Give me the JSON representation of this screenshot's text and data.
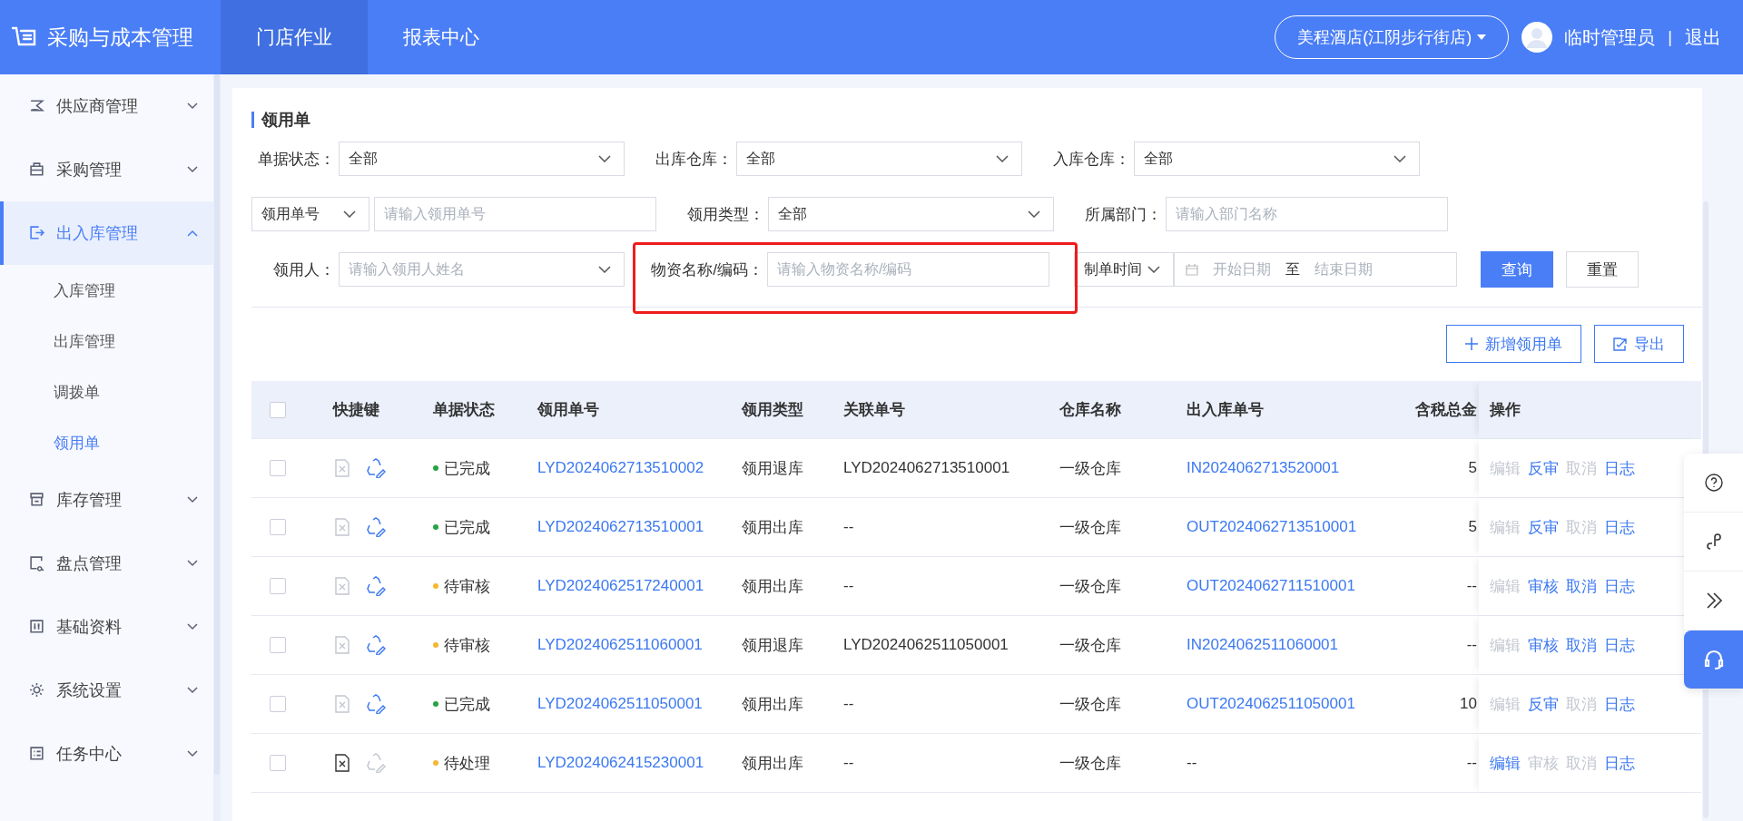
{
  "header": {
    "app_title": "采购与成本管理",
    "nav": [
      {
        "label": "门店作业",
        "selected": true
      },
      {
        "label": "报表中心",
        "selected": false
      }
    ],
    "store": "美程酒店(江阴步行街店)",
    "user": "临时管理员",
    "separator": "|",
    "logout": "退出"
  },
  "sidebar": {
    "items": [
      {
        "label": "供应商管理",
        "expanded": false,
        "selected": false
      },
      {
        "label": "采购管理",
        "expanded": false,
        "selected": false
      },
      {
        "label": "出入库管理",
        "expanded": true,
        "selected": true,
        "children": [
          {
            "label": "入库管理",
            "selected": false
          },
          {
            "label": "出库管理",
            "selected": false
          },
          {
            "label": "调拨单",
            "selected": false
          },
          {
            "label": "领用单",
            "selected": true
          }
        ]
      },
      {
        "label": "库存管理",
        "expanded": false,
        "selected": false
      },
      {
        "label": "盘点管理",
        "expanded": false,
        "selected": false
      },
      {
        "label": "基础资料",
        "expanded": false,
        "selected": false
      },
      {
        "label": "系统设置",
        "expanded": false,
        "selected": false
      },
      {
        "label": "任务中心",
        "expanded": false,
        "selected": false
      }
    ]
  },
  "page_title": "领用单",
  "filters": [
    [
      {
        "kind": "select",
        "label": "单据状态：",
        "value": "全部"
      },
      {
        "kind": "select",
        "label": "出库仓库：",
        "value": "全部"
      },
      {
        "kind": "select",
        "label": "入库仓库：",
        "value": "全部"
      }
    ],
    [
      {
        "kind": "combo",
        "value": "领用单号",
        "placeholder": "请输入领用单号"
      },
      {
        "kind": "select",
        "label": "领用类型：",
        "value": "全部"
      },
      {
        "kind": "input",
        "label": "所属部门：",
        "placeholder": "请输入部门名称"
      }
    ],
    [
      {
        "kind": "select",
        "label": "领用人：",
        "placeholder": "请输入领用人姓名"
      },
      {
        "kind": "input",
        "label": "物资名称/编码：",
        "placeholder": "请输入物资名称/编码"
      },
      {
        "kind": "daterange",
        "value": "制单时间",
        "start": "开始日期",
        "separator": "至",
        "end": "结束日期"
      },
      {
        "kind": "button",
        "label": "查询",
        "primary": true
      },
      {
        "kind": "button",
        "label": "重置",
        "primary": false
      }
    ]
  ],
  "annotation": {
    "kind": "highlight-box"
  },
  "actions": [
    {
      "kind": "add",
      "label": "新增领用单"
    },
    {
      "kind": "export",
      "label": "导出"
    }
  ],
  "table": {
    "select_all": {
      "checked": false
    },
    "columns": [
      "快捷键",
      "单据状态",
      "领用单号",
      "领用类型",
      "关联单号",
      "仓库名称",
      "出入库单号",
      "含税总金",
      "操作"
    ],
    "rows": [
      {
        "checked": false,
        "shortcuts": [
          {
            "kind": "void",
            "disabled": true
          },
          {
            "kind": "reverse",
            "disabled": false
          }
        ],
        "status": "已完成",
        "color": "#27a243",
        "number": "LYD2024062713510002",
        "type": "领用退库",
        "related": "LYD2024062713510001",
        "warehouse": "一级仓库",
        "io_number": "IN2024062713520001",
        "io_link": true,
        "amount": "5",
        "ops": [
          {
            "label": "编辑",
            "disabled": true
          },
          {
            "label": "反审",
            "disabled": false
          },
          {
            "label": "取消",
            "disabled": true
          },
          {
            "label": "日志",
            "disabled": false
          }
        ]
      },
      {
        "checked": false,
        "shortcuts": [
          {
            "kind": "void",
            "disabled": true
          },
          {
            "kind": "reverse",
            "disabled": false
          }
        ],
        "status": "已完成",
        "color": "#27a243",
        "number": "LYD2024062713510001",
        "type": "领用出库",
        "related": "--",
        "warehouse": "一级仓库",
        "io_number": "OUT2024062713510001",
        "io_link": true,
        "amount": "5",
        "ops": [
          {
            "label": "编辑",
            "disabled": true
          },
          {
            "label": "反审",
            "disabled": false
          },
          {
            "label": "取消",
            "disabled": true
          },
          {
            "label": "日志",
            "disabled": false
          }
        ]
      },
      {
        "checked": false,
        "shortcuts": [
          {
            "kind": "void",
            "disabled": true
          },
          {
            "kind": "reverse",
            "disabled": false
          }
        ],
        "status": "待审核",
        "color": "#f5b731",
        "number": "LYD2024062517240001",
        "type": "领用出库",
        "related": "--",
        "warehouse": "一级仓库",
        "io_number": "OUT2024062711510001",
        "io_link": true,
        "amount": "--",
        "ops": [
          {
            "label": "编辑",
            "disabled": true
          },
          {
            "label": "审核",
            "disabled": false
          },
          {
            "label": "取消",
            "disabled": false
          },
          {
            "label": "日志",
            "disabled": false
          }
        ]
      },
      {
        "checked": false,
        "shortcuts": [
          {
            "kind": "void",
            "disabled": true
          },
          {
            "kind": "reverse",
            "disabled": false
          }
        ],
        "status": "待审核",
        "color": "#f5b731",
        "number": "LYD2024062511060001",
        "type": "领用退库",
        "related": "LYD2024062511050001",
        "warehouse": "一级仓库",
        "io_number": "IN2024062511060001",
        "io_link": true,
        "amount": "--",
        "ops": [
          {
            "label": "编辑",
            "disabled": true
          },
          {
            "label": "审核",
            "disabled": false
          },
          {
            "label": "取消",
            "disabled": false
          },
          {
            "label": "日志",
            "disabled": false
          }
        ]
      },
      {
        "checked": false,
        "shortcuts": [
          {
            "kind": "void",
            "disabled": true
          },
          {
            "kind": "reverse",
            "disabled": false
          }
        ],
        "status": "已完成",
        "color": "#27a243",
        "number": "LYD2024062511050001",
        "type": "领用出库",
        "related": "--",
        "warehouse": "一级仓库",
        "io_number": "OUT2024062511050001",
        "io_link": true,
        "amount": "10",
        "ops": [
          {
            "label": "编辑",
            "disabled": true
          },
          {
            "label": "反审",
            "disabled": false
          },
          {
            "label": "取消",
            "disabled": true
          },
          {
            "label": "日志",
            "disabled": false
          }
        ]
      },
      {
        "checked": false,
        "shortcuts": [
          {
            "kind": "void",
            "disabled": false
          },
          {
            "kind": "reverse",
            "disabled": true
          }
        ],
        "status": "待处理",
        "color": "#f5b731",
        "number": "LYD2024062415230001",
        "type": "领用出库",
        "related": "--",
        "warehouse": "一级仓库",
        "io_number": "--",
        "io_link": false,
        "amount": "--",
        "ops": [
          {
            "label": "编辑",
            "disabled": false
          },
          {
            "label": "审核",
            "disabled": true
          },
          {
            "label": "取消",
            "disabled": true
          },
          {
            "label": "日志",
            "disabled": false
          }
        ]
      }
    ]
  },
  "float_tools": [
    {
      "kind": "help"
    },
    {
      "kind": "link"
    },
    {
      "kind": "collapse"
    },
    {
      "kind": "support"
    }
  ]
}
